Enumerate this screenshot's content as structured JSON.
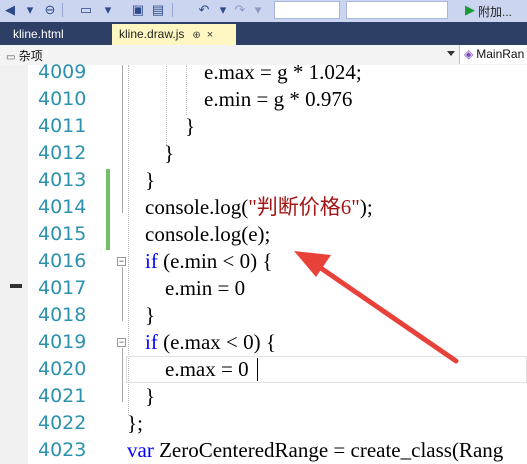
{
  "toolbar": {
    "attach_label": "附加..."
  },
  "tabs": [
    {
      "label": "kline.html",
      "active": false
    },
    {
      "label": "kline.draw.js",
      "active": true,
      "pin": "⊕",
      "close": "×"
    }
  ],
  "nav": {
    "left_label": "杂项",
    "right_label": "MainRan"
  },
  "lines": [
    {
      "num": "4009",
      "code": "e.max = g * 1.024;"
    },
    {
      "num": "4010",
      "code": "e.min = g * 0.976"
    },
    {
      "num": "4011",
      "code": "}"
    },
    {
      "num": "4012",
      "code": "}"
    },
    {
      "num": "4013",
      "code": "}"
    },
    {
      "num": "4014",
      "pre": "console.log(",
      "str": "\"判断价格6\"",
      "post": ");"
    },
    {
      "num": "4015",
      "code": "console.log(e);"
    },
    {
      "num": "4016",
      "kw": "if",
      "code": " (e.min < 0) {"
    },
    {
      "num": "4017",
      "code": "e.min = 0"
    },
    {
      "num": "4018",
      "code": "}"
    },
    {
      "num": "4019",
      "kw": "if",
      "code": " (e.max < 0) {"
    },
    {
      "num": "4020",
      "code": "e.max = 0"
    },
    {
      "num": "4021",
      "code": "}"
    },
    {
      "num": "4022",
      "code": "};"
    },
    {
      "num": "4023",
      "kw": "var",
      "code": " ZeroCenteredRange = create_class(Rang"
    }
  ],
  "colors": {
    "line_number": "#2b91af",
    "keyword": "#0000ff",
    "string": "#a31515",
    "annotation_arrow": "#e8413a",
    "changed_marker": "#6fc26a"
  }
}
